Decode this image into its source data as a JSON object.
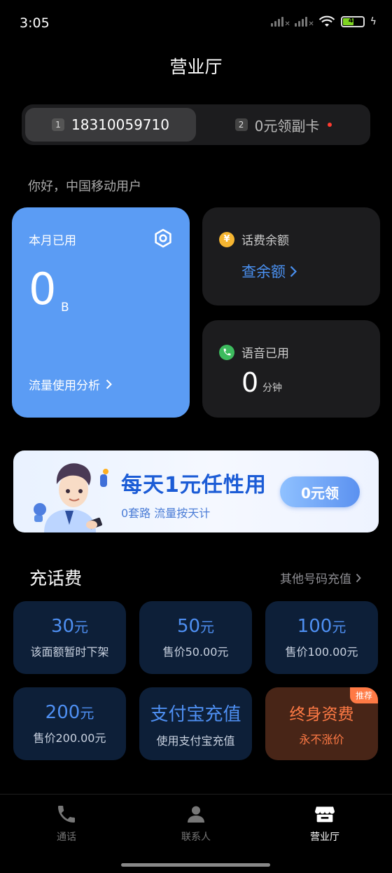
{
  "status_bar": {
    "time": "3:05",
    "battery": "47"
  },
  "header": {
    "title": "营业厅"
  },
  "sim_selector": {
    "sim1": {
      "index": "1",
      "label": "18310059710"
    },
    "sim2": {
      "index": "2",
      "label": "0元领副卡"
    }
  },
  "greeting": "你好，中国移动用户",
  "data_card": {
    "label": "本月已用",
    "value": "0",
    "unit": "B",
    "link": "流量使用分析"
  },
  "balance_card": {
    "label": "话费余额",
    "coin_icon": "¥",
    "link": "查余额"
  },
  "voice_card": {
    "label": "语音已用",
    "value": "0",
    "unit": "分钟"
  },
  "banner": {
    "title": "每天1元任性用",
    "subtitle": "0套路 流量按天计",
    "cta": "0元领"
  },
  "recharge": {
    "title": "充话费",
    "other_link": "其他号码充值",
    "tiles": [
      {
        "amount": "30",
        "unit": "元",
        "desc": "该面额暂时下架"
      },
      {
        "amount": "50",
        "unit": "元",
        "desc": "售价50.00元"
      },
      {
        "amount": "100",
        "unit": "元",
        "desc": "售价100.00元"
      },
      {
        "amount": "200",
        "unit": "元",
        "desc": "售价200.00元"
      },
      {
        "amount": "支付宝充值",
        "unit": "",
        "desc": "使用支付宝充值"
      },
      {
        "amount": "终身资费",
        "unit": "",
        "desc": "永不涨价",
        "badge": "推荐"
      }
    ]
  },
  "bottom_nav": {
    "calls": "通话",
    "contacts": "联系人",
    "store": "营业厅"
  },
  "colors": {
    "accent_blue": "#5b9cf4",
    "link_blue": "#4a90f0",
    "hot_orange": "#ff7a45"
  }
}
